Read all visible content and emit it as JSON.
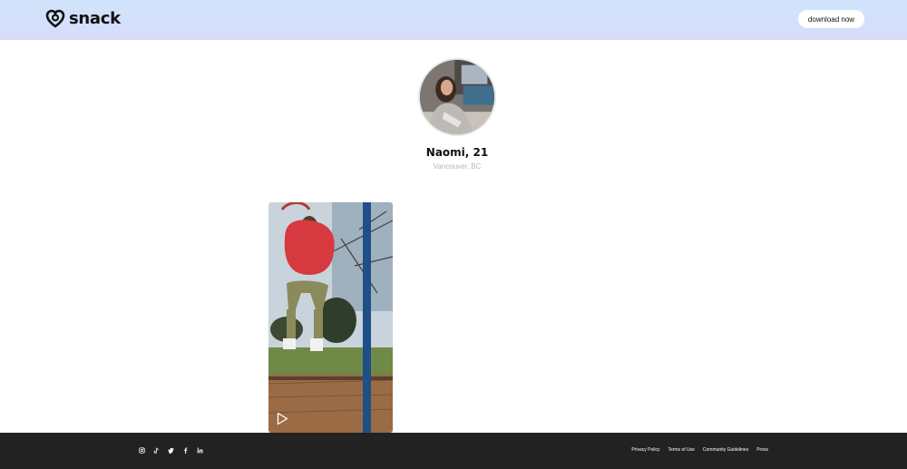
{
  "header": {
    "logo_text": "snack",
    "download_label": "download now"
  },
  "profile": {
    "name": "Naomi, 21",
    "location": "Vancouver, BC"
  },
  "video": {
    "play_icon": "play-icon"
  },
  "footer": {
    "social_icons": [
      "instagram-icon",
      "tiktok-icon",
      "twitter-icon",
      "facebook-icon",
      "linkedin-icon"
    ],
    "links": {
      "privacy": "Privacy Policy",
      "terms": "Terms of Use",
      "guidelines": "Community Guidelines",
      "press": "Press"
    }
  },
  "colors": {
    "header_gradient_start": "#cfe4fb",
    "header_gradient_end": "#d7dcfb",
    "footer_bg": "#222222",
    "location_text": "#b5b5b5"
  }
}
